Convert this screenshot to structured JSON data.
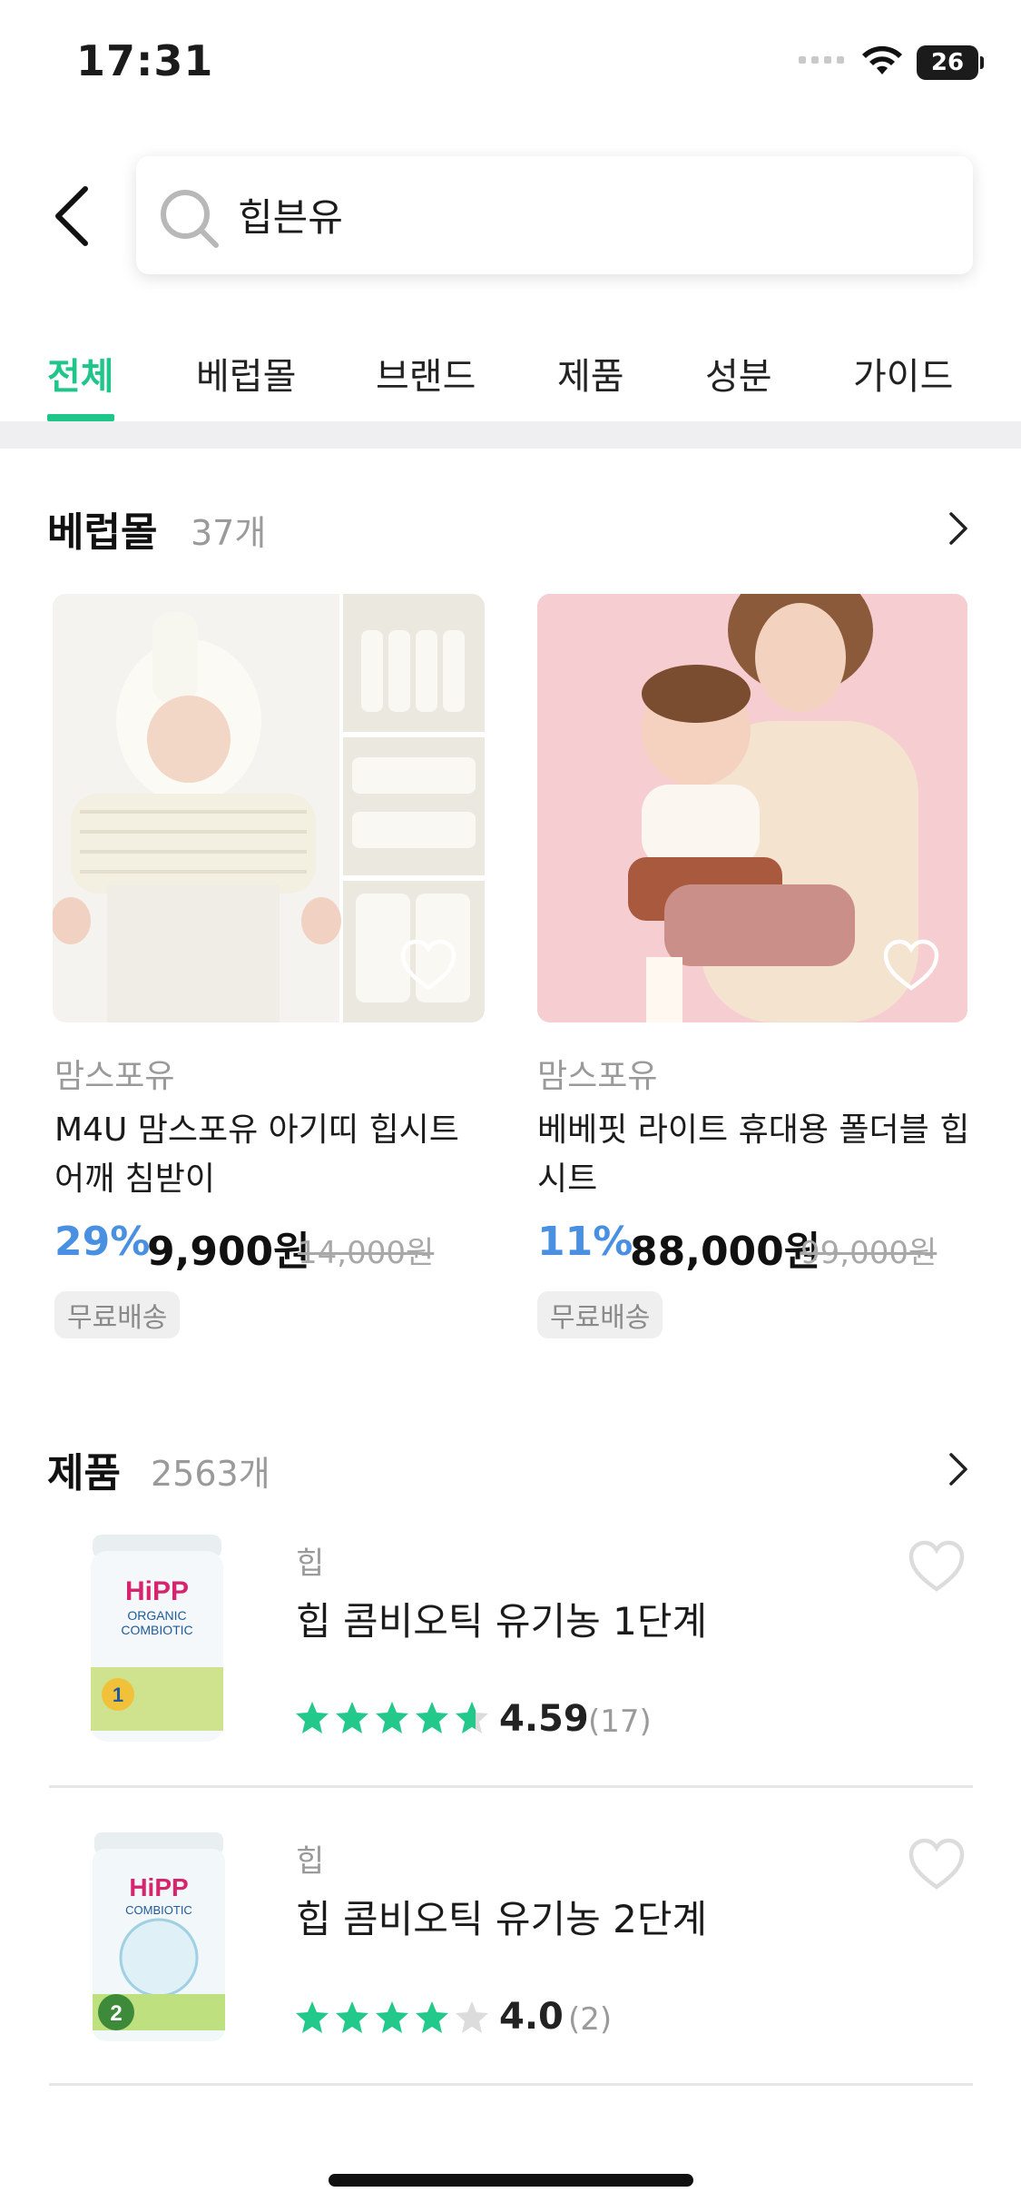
{
  "status": {
    "time": "17:31",
    "battery": "26"
  },
  "search": {
    "query": "힙븐유"
  },
  "tabs": [
    {
      "label": "전체"
    },
    {
      "label": "베럽몰"
    },
    {
      "label": "브랜드"
    },
    {
      "label": "제품"
    },
    {
      "label": "성분"
    },
    {
      "label": "가이드"
    }
  ],
  "mall": {
    "title": "베럽몰",
    "count": "37개",
    "items": [
      {
        "brand": "맘스포유",
        "name": "M4U 맘스포유 아기띠 힙시트 어깨 침받이",
        "discount": "29%",
        "price": "9,900원",
        "original": "14,000원",
        "badge": "무료배송"
      },
      {
        "brand": "맘스포유",
        "name": "베베핏 라이트 휴대용 폴더블 힙시트",
        "discount": "11%",
        "price": "88,000원",
        "original": "99,000원",
        "badge": "무료배송"
      }
    ]
  },
  "products": {
    "title": "제품",
    "count": "2563개",
    "items": [
      {
        "brand": "힙",
        "name": "힙 콤비오틱 유기농 1단계",
        "rating": "4.59",
        "rating_value": 4.59,
        "reviews": "(17)",
        "can_label": "HiPP",
        "can_sub": "COMBIOTIC",
        "stage": "1"
      },
      {
        "brand": "힙",
        "name": "힙 콤비오틱 유기농 2단계",
        "rating": "4.0",
        "rating_value": 4.0,
        "reviews": "(2)",
        "can_label": "HiPP",
        "can_sub": "COMBIOTIC",
        "stage": "2"
      }
    ]
  },
  "colors": {
    "accent": "#1ec68a",
    "discount": "#4a90e2",
    "star": "#22c98a"
  }
}
